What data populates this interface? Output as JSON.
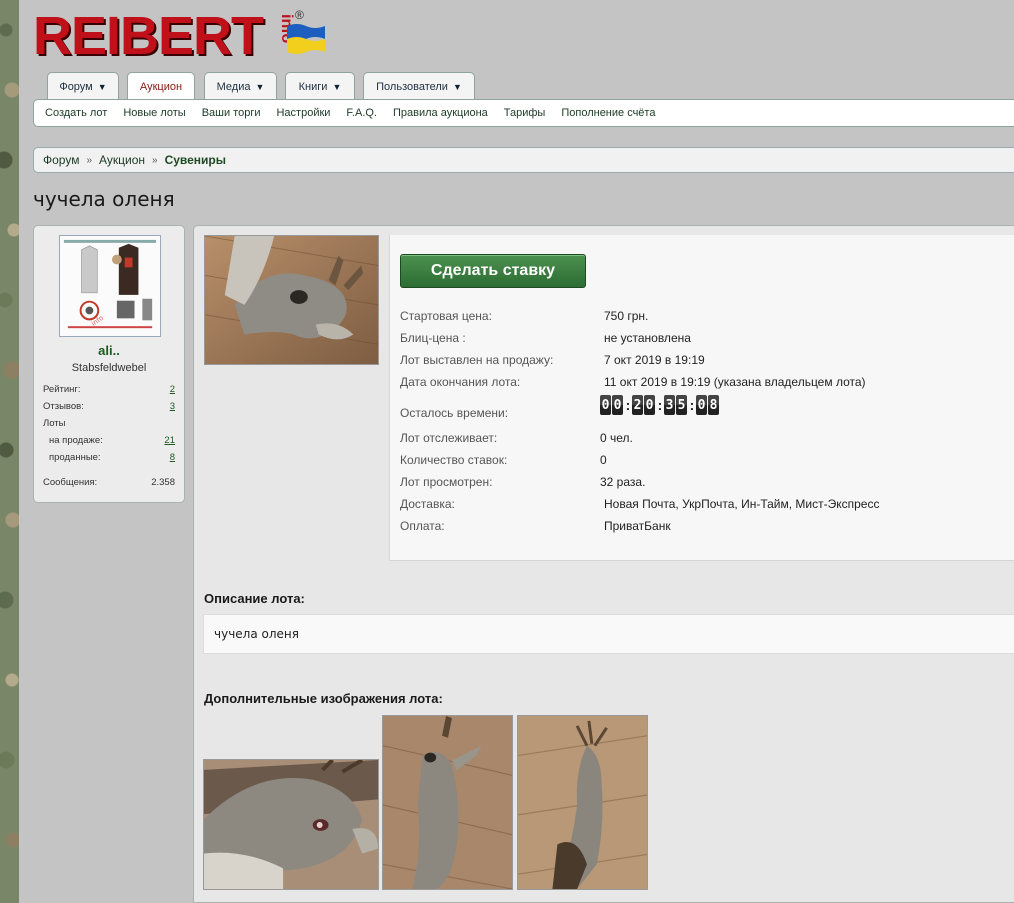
{
  "logo": {
    "text": "REIBERT",
    "suffix": "info",
    "reg": "®"
  },
  "colors": {
    "brand_red": "#c0101a",
    "accent_green": "#2d6d34",
    "flag_blue": "#1c5fbf",
    "flag_yellow": "#f2cf1d"
  },
  "tabs": [
    {
      "label": "Форум",
      "dropdown": true,
      "active": false
    },
    {
      "label": "Аукцион",
      "dropdown": false,
      "active": true
    },
    {
      "label": "Медиа",
      "dropdown": true,
      "active": false
    },
    {
      "label": "Книги",
      "dropdown": true,
      "active": false
    },
    {
      "label": "Пользователи",
      "dropdown": true,
      "active": false
    }
  ],
  "subnav": [
    "Создать лот",
    "Новые лоты",
    "Ваши торги",
    "Настройки",
    "F.A.Q.",
    "Правила аукциона",
    "Тарифы",
    "Пополнение счёта"
  ],
  "breadcrumb": {
    "items": [
      "Форум",
      "Аукцион"
    ],
    "current": "Сувениры",
    "separator": "»"
  },
  "page_title": "чучела оленя",
  "user": {
    "name": "ali..",
    "rank": "Stabsfeldwebel",
    "stats": [
      {
        "label": "Рейтинг:",
        "value": "2",
        "link": true
      },
      {
        "label": "Отзывов:",
        "value": "3",
        "link": true
      },
      {
        "label": "Лоты",
        "value": "",
        "link": false
      },
      {
        "label": "на продаже:",
        "value": "21",
        "link": true
      },
      {
        "label": "проданные:",
        "value": "8",
        "link": true
      },
      {
        "label": "Сообщения:",
        "value": "2.358",
        "link": false
      }
    ]
  },
  "bid_button": "Сделать ставку",
  "lot": {
    "rows": [
      {
        "label": "Стартовая цена:",
        "value": "750 грн."
      },
      {
        "label": "Блиц-цена :",
        "value": "не установлена"
      },
      {
        "label": "Лот выставлен на продажу:",
        "value": "7 окт 2019 в 19:19"
      },
      {
        "label": "Дата окончания лота:",
        "value": "11 окт 2019 в 19:19 (указана владельцем лота)"
      }
    ],
    "time_left_label": "Осталось времени:",
    "timer": [
      "00",
      "20",
      "35",
      "08"
    ],
    "rows2": [
      {
        "label": "Лот отслеживает:",
        "value": "0 чел."
      },
      {
        "label": "Количество ставок:",
        "value": "0"
      },
      {
        "label": "Лот просмотрен:",
        "value": "32 раза."
      },
      {
        "label": "Доставка:",
        "value": "Новая Почта, УкрПочта, Ин-Тайм, Мист-Экспресс"
      },
      {
        "label": "Оплата:",
        "value": "ПриватБанк"
      }
    ]
  },
  "description": {
    "heading": "Описание лота:",
    "text": "чучела оленя"
  },
  "extra_images": {
    "heading": "Дополнительные изображения лота:",
    "count": 3
  }
}
